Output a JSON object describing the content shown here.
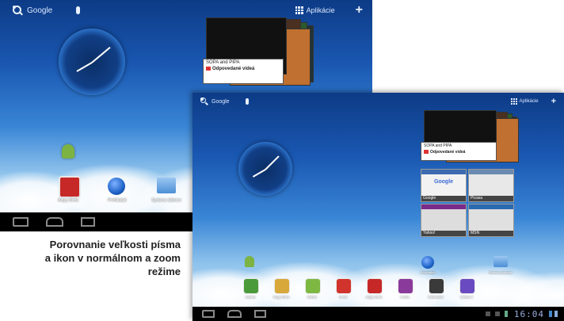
{
  "caption": {
    "line1": "Porovnanie veľkosti písma",
    "line2": "a ikon v normálnom a zoom",
    "line3": "režime"
  },
  "normal_screen": {
    "search_label": "Google",
    "apps_label": "Aplikácie",
    "recents_card": {
      "title": "SOPA and PIPA",
      "subtitle": "Odpovedané videá"
    },
    "dock": [
      {
        "label": "Angry Birds",
        "color": "#c62828"
      },
      {
        "label": "Prehliadač",
        "color": "#1e63c8"
      },
      {
        "label": "Správca súborov",
        "color": "#4c8fd6"
      }
    ]
  },
  "zoom_screen": {
    "search_label": "Google",
    "apps_label": "Aplikácie",
    "recents_card": {
      "title": "SOPA and PIPA",
      "subtitle": "Odpovedané videá"
    },
    "widgets": [
      {
        "label": "Google"
      },
      {
        "label": "Picasa"
      },
      {
        "label": "Yahoo!"
      },
      {
        "label": "MSN"
      }
    ],
    "upper_icons": [
      {
        "label": "Prehliadač"
      },
      {
        "label": "Správca súborov"
      }
    ],
    "dock": [
      {
        "label": "Galéria",
        "color": "#4b9a3a"
      },
      {
        "label": "Angry Birds",
        "color": "#d8a83a"
      },
      {
        "label": "Market",
        "color": "#7db843"
      },
      {
        "label": "Gmail",
        "color": "#d0342c"
      },
      {
        "label": "Angry Birds",
        "color": "#c62828"
      },
      {
        "label": "Hudba",
        "color": "#8a3a9a"
      },
      {
        "label": "Kalkulačka",
        "color": "#3a3a3a"
      },
      {
        "label": "Galéria 2",
        "color": "#6a4ac0"
      }
    ],
    "status_time": "16:04"
  }
}
